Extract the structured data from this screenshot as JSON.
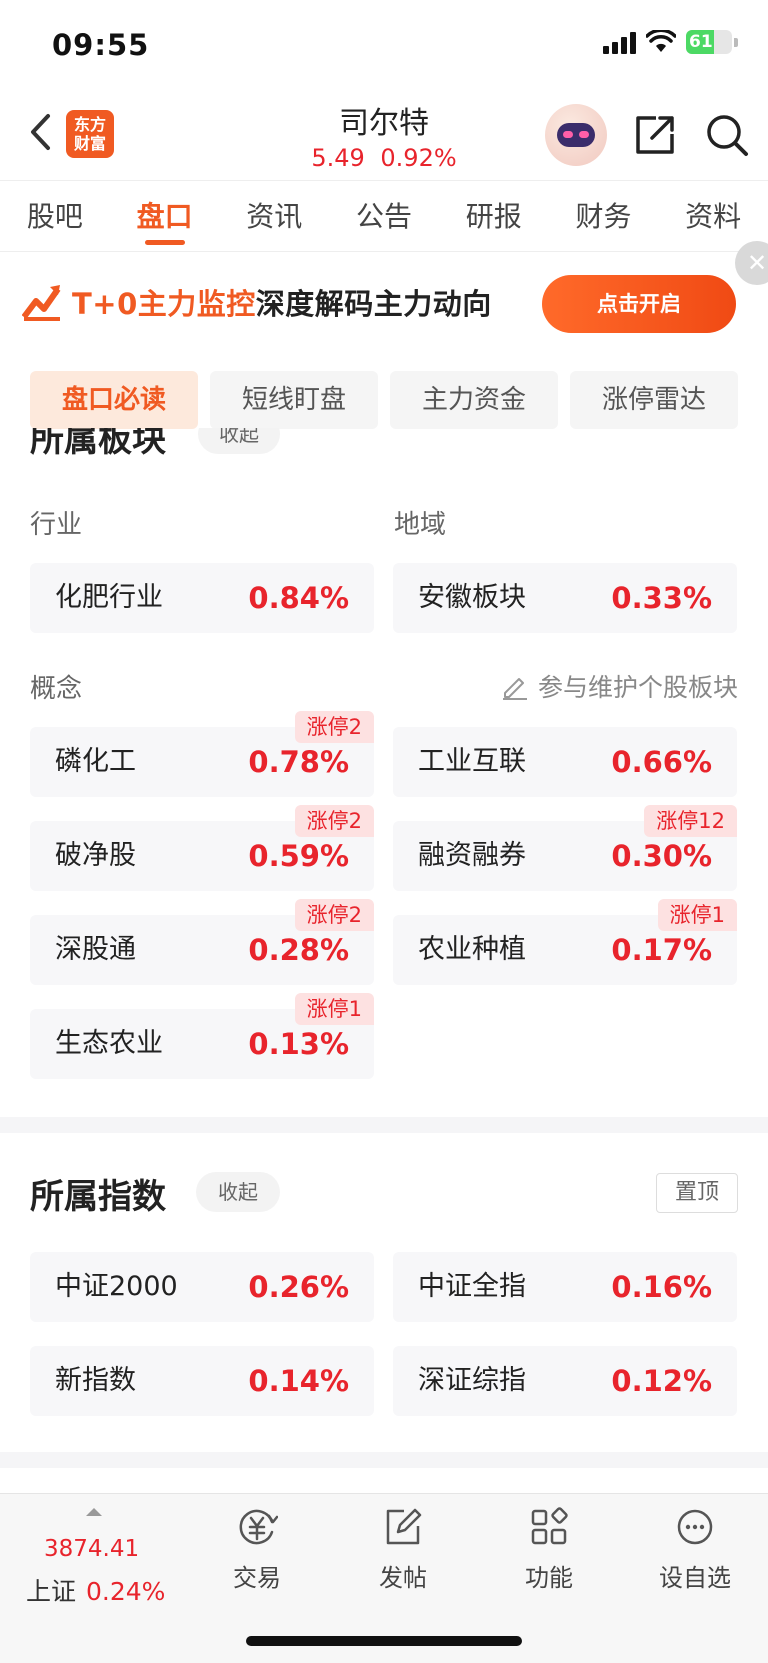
{
  "status_bar": {
    "time": "09:55",
    "battery": "61",
    "battery_level": 0.61
  },
  "header": {
    "logo_line1": "东方",
    "logo_line2": "财富",
    "stock_name": "司尔特",
    "price": "5.49",
    "change": "0.92%"
  },
  "tabs": [
    {
      "label": "股吧"
    },
    {
      "label": "盘口",
      "active": true
    },
    {
      "label": "资讯"
    },
    {
      "label": "公告"
    },
    {
      "label": "研报"
    },
    {
      "label": "财务"
    },
    {
      "label": "资料"
    }
  ],
  "banner": {
    "highlight": "T+0主力监控",
    "text": "深度解码主力动向",
    "button": "点击开启",
    "close": "✕"
  },
  "subtabs": [
    {
      "label": "盘口必读",
      "active": true
    },
    {
      "label": "短线盯盘"
    },
    {
      "label": "主力资金"
    },
    {
      "label": "涨停雷达"
    }
  ],
  "sector_section": {
    "title": "所属板块",
    "collapse": "收起",
    "industry_label": "行业",
    "region_label": "地域",
    "industry": {
      "name": "化肥行业",
      "change": "0.84%"
    },
    "region": {
      "name": "安徽板块",
      "change": "0.33%"
    },
    "concept_label": "概念",
    "edit_link": "参与维护个股板块",
    "concepts": [
      {
        "name": "磷化工",
        "change": "0.78%",
        "badge": "涨停2"
      },
      {
        "name": "工业互联",
        "change": "0.66%",
        "badge": ""
      },
      {
        "name": "破净股",
        "change": "0.59%",
        "badge": "涨停2"
      },
      {
        "name": "融资融券",
        "change": "0.30%",
        "badge": "涨停12"
      },
      {
        "name": "深股通",
        "change": "0.28%",
        "badge": "涨停2"
      },
      {
        "name": "农业种植",
        "change": "0.17%",
        "badge": "涨停1"
      },
      {
        "name": "生态农业",
        "change": "0.13%",
        "badge": "涨停1"
      }
    ]
  },
  "index_section": {
    "title": "所属指数",
    "collapse": "收起",
    "pin": "置顶",
    "items": [
      {
        "name": "中证2000",
        "change": "0.26%"
      },
      {
        "name": "中证全指",
        "change": "0.16%"
      },
      {
        "name": "新指数",
        "change": "0.14%"
      },
      {
        "name": "深证综指",
        "change": "0.12%"
      }
    ]
  },
  "bottom_bar": {
    "index_value": "3874.41",
    "index_name": "上证",
    "index_change": "0.24%",
    "nav": [
      {
        "label": "交易",
        "icon": "trade-icon"
      },
      {
        "label": "发帖",
        "icon": "post-icon"
      },
      {
        "label": "功能",
        "icon": "apps-icon"
      },
      {
        "label": "设自选",
        "icon": "more-icon"
      }
    ]
  },
  "colors": {
    "accent": "#f05a22",
    "up": "#e8242c"
  }
}
